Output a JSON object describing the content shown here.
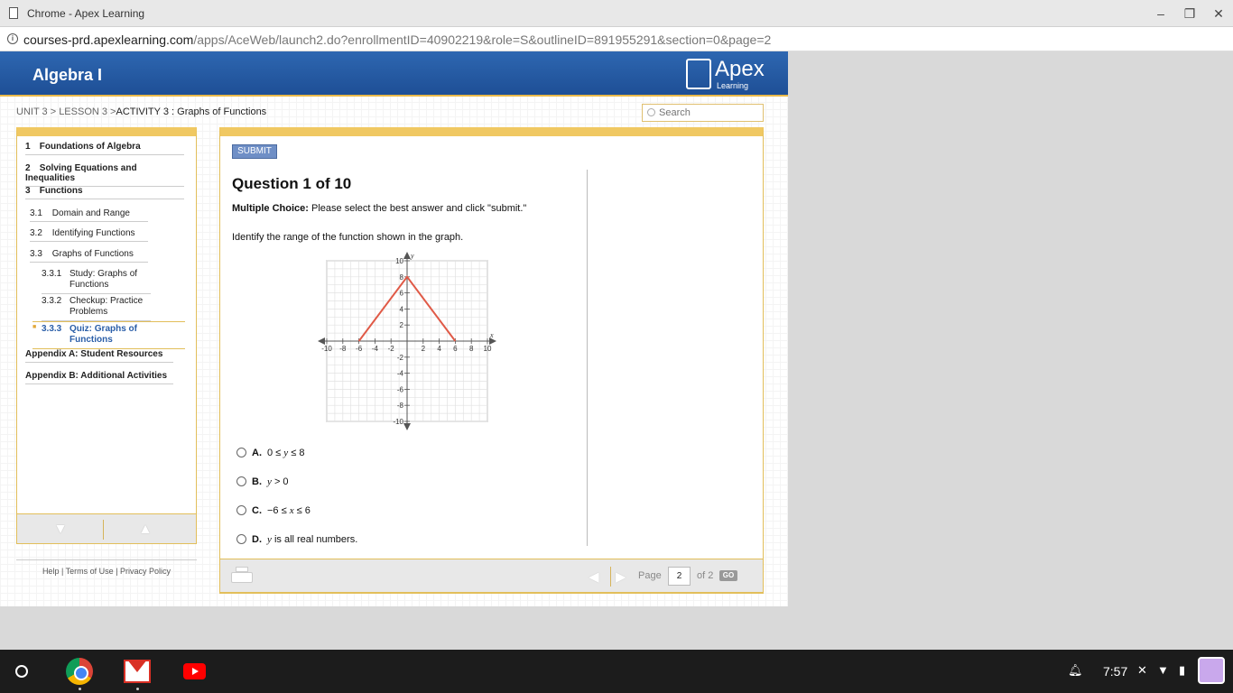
{
  "window": {
    "title": "Chrome - Apex Learning",
    "minimize": "–",
    "restore": "❐",
    "close": "✕"
  },
  "address": {
    "host": "courses-prd.apexlearning.com",
    "path": "/apps/AceWeb/launch2.do?enrollmentID=40902219&role=S&outlineID=891955291&section=0&page=2"
  },
  "header": {
    "course": "Algebra I",
    "logo_name": "Apex",
    "logo_sub": "Learning"
  },
  "breadcrumb": {
    "unit": "UNIT 3",
    "lesson": "LESSON 3",
    "activity": "ACTIVITY 3 : Graphs of Functions"
  },
  "search": {
    "placeholder": "Search"
  },
  "sidebar": {
    "items": [
      {
        "num": "1",
        "label": "Foundations of Algebra"
      },
      {
        "num": "2",
        "label": "Solving Equations and Inequalities"
      },
      {
        "num": "3",
        "label": "Functions"
      },
      {
        "num": "3.1",
        "label": "Domain and Range"
      },
      {
        "num": "3.2",
        "label": "Identifying Functions"
      },
      {
        "num": "3.3",
        "label": "Graphs of Functions"
      },
      {
        "num": "3.3.1",
        "label": "Study: Graphs of Functions"
      },
      {
        "num": "3.3.2",
        "label": "Checkup: Practice Problems"
      },
      {
        "num": "3.3.3",
        "label": "Quiz: Graphs of Functions"
      },
      {
        "num": "",
        "label": "Appendix A: Student Resources"
      },
      {
        "num": "",
        "label": "Appendix B: Additional Activities"
      }
    ]
  },
  "footer": {
    "help": "Help",
    "sep1": "|",
    "terms": "Terms of Use",
    "sep2": "|",
    "privacy": "Privacy Policy"
  },
  "question": {
    "submit": "SUBMIT",
    "title": "Question 1 of 10",
    "type": "Multiple Choice:",
    "instruction": "Please select the best answer and click \"submit.\"",
    "prompt": "Identify the range of the function shown in the graph.",
    "choices": [
      {
        "letter": "A.",
        "pre": "0 ≤ ",
        "var": "y",
        "post": " ≤ 8"
      },
      {
        "letter": "B.",
        "pre": "",
        "var": "y",
        "post": " > 0"
      },
      {
        "letter": "C.",
        "pre": "−6 ≤ ",
        "var": "x",
        "post": " ≤ 6"
      },
      {
        "letter": "D.",
        "pre": "",
        "var": "y",
        "post": " is all real numbers."
      }
    ]
  },
  "graph": {
    "x_label": "x",
    "y_label": "y",
    "xlim": [
      -10,
      10
    ],
    "ylim": [
      -10,
      10
    ],
    "x_ticks": [
      -10,
      -8,
      -6,
      -4,
      -2,
      2,
      4,
      6,
      8,
      10
    ],
    "y_ticks": [
      10,
      8,
      6,
      4,
      2,
      -2,
      -4,
      -6,
      -8,
      -10
    ],
    "x_tick_labels": [
      "-10",
      "-8",
      "-6",
      "-4",
      "-2",
      "2",
      "4",
      "6",
      "8",
      "10"
    ],
    "y_tick_labels": [
      "10",
      "8",
      "6",
      "4",
      "2",
      "-2",
      "-4",
      "-6",
      "-8",
      "-10"
    ],
    "points": [
      [
        -6,
        0
      ],
      [
        0,
        8
      ],
      [
        6,
        0
      ]
    ],
    "line_color": "#e05a47"
  },
  "pager": {
    "page_label": "Page",
    "current": "2",
    "of": "of 2",
    "go": "GO"
  },
  "taskbar": {
    "time": "7:57"
  }
}
